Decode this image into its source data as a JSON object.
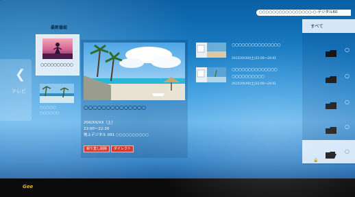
{
  "breadcrumb": "○○○○○○○○○○○○○○○○-○-デジタル60",
  "left_nav": {
    "icon": "chevron-left-icon",
    "label": "テレビ"
  },
  "category": {
    "title": "最新番組"
  },
  "recordings": [
    {
      "title": "○○○○○○○○○○"
    },
    {
      "title_line1": "○○○○○",
      "title_line2": "○○○○○○"
    }
  ],
  "detail": {
    "program_title": "○○○○○○○○○○○○○○",
    "date": "20X/XX/XX（土）",
    "time": "22:00～22:30",
    "channel": "地上デジタル 091 ○○○○○○○○○○",
    "delete_label": "録り直し削除",
    "play_label": "ダイレクト"
  },
  "list": [
    {
      "line1": "○○○○○○○○○○○○○○○",
      "line2": "",
      "meta": "2015/XX/X0(土)22:00～24:01"
    },
    {
      "line1": "○○○○○○○○○○○○○○",
      "line2": "○○○○○○○○○○",
      "meta": "2015/XX/X0(土)22:00～24:01"
    }
  ],
  "right_panel": {
    "all_label": "すべて",
    "folders": [
      {
        "icon": "folder-icon",
        "label": "○",
        "lock": ""
      },
      {
        "icon": "folder-icon",
        "label": "○",
        "lock": ""
      },
      {
        "icon": "folder-icon",
        "label": "○",
        "lock": ""
      },
      {
        "icon": "folder-icon",
        "label": "○",
        "lock": ""
      },
      {
        "icon": "folder-open-icon",
        "label": "○",
        "lock": "🔒"
      }
    ]
  },
  "footer": {
    "brand": "Gee"
  },
  "colors": {
    "accent": "#d9382f",
    "brand": "#f0b400",
    "panel_light": "#ebf5ff"
  }
}
